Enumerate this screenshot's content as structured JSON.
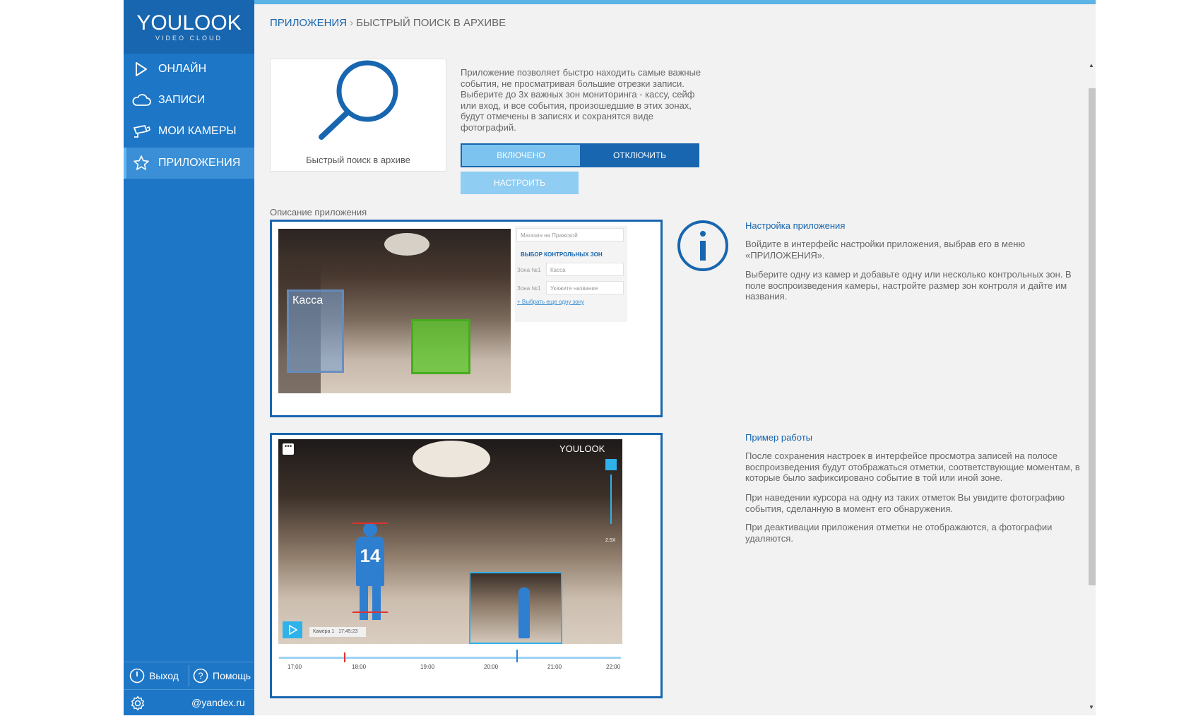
{
  "brand": {
    "name": "YOULOOK",
    "tagline": "VIDEO CLOUD"
  },
  "sidebar": {
    "items": [
      {
        "label": "ОНЛАЙН",
        "icon": "play-icon"
      },
      {
        "label": "ЗАПИСИ",
        "icon": "cloud-icon"
      },
      {
        "label": "МОИ КАМЕРЫ",
        "icon": "camera-icon"
      },
      {
        "label": "ПРИЛОЖЕНИЯ",
        "icon": "star-icon",
        "active": true
      }
    ],
    "logout_label": "Выход",
    "help_label": "Помощь",
    "account": "@yandex.ru"
  },
  "breadcrumb": {
    "root": "ПРИЛОЖЕНИЯ",
    "current": "БЫСТРЫЙ ПОИСК В АРХИВЕ"
  },
  "app": {
    "name": "Быстрый поиск в архиве",
    "description": "Приложение позволяет быстро находить самые важные события, не просматривая большие отрезки записи. Выберите до 3х важных зон мониторинга - кассу, сейф или вход, и все события, произошедшие в этих зонах, будут отмечены в записях и сохранятся виде фотографий.",
    "btn_enabled": "ВКЛЮЧЕНО",
    "btn_disable": "ОТКЛЮЧИТЬ",
    "btn_configure": "НАСТРОИТЬ"
  },
  "section_label": "Описание приложения",
  "demo1": {
    "zone_label": "Касса",
    "store_name": "Магазин на Пражской",
    "zones_heading": "ВЫБОР КОНТРОЛЬНЫХ ЗОН",
    "zone1_label": "Зона №1",
    "zone1_value": "Касса",
    "zone2_label": "Зона №1",
    "zone2_placeholder": "Укажите название",
    "add_zone": "Выбрать еще одну зону"
  },
  "demo2": {
    "brand": "YOULOOK",
    "person_number": "14",
    "camera": "Камера 1",
    "time": "17:45:23",
    "zoom": "2.5X",
    "timeline": [
      "17:00",
      "18:00",
      "19:00",
      "20:00",
      "21:00",
      "22:00"
    ]
  },
  "setup": {
    "title": "Настройка приложения",
    "p1": "Войдите в интерфейс настройки приложения, выбрав его в меню «ПРИЛОЖЕНИЯ».",
    "p2": "Выберите одну из камер и добавьте одну или несколько контрольных зон. В поле воспроизведения камеры, настройте размер зон контроля и дайте им названия."
  },
  "example": {
    "title": "Пример работы",
    "p1": "После сохранения настроек в интерфейсе просмотра записей на полосе воспроизведения будут отображаться отметки, соответствующие моментам, в которые было зафиксировано событие в той или иной зоне.",
    "p2": "При наведении курсора на одну из таких отметок Вы увидите фотографию события, сделанную в момент его обнаружения.",
    "p3": "При деактивации приложения отметки не отображаются, а фотографии удаляются."
  },
  "colors": {
    "primary": "#1866af",
    "sidebar": "#1d76c6",
    "accent": "#5bb4e5",
    "button_light": "#7cc3ef"
  }
}
